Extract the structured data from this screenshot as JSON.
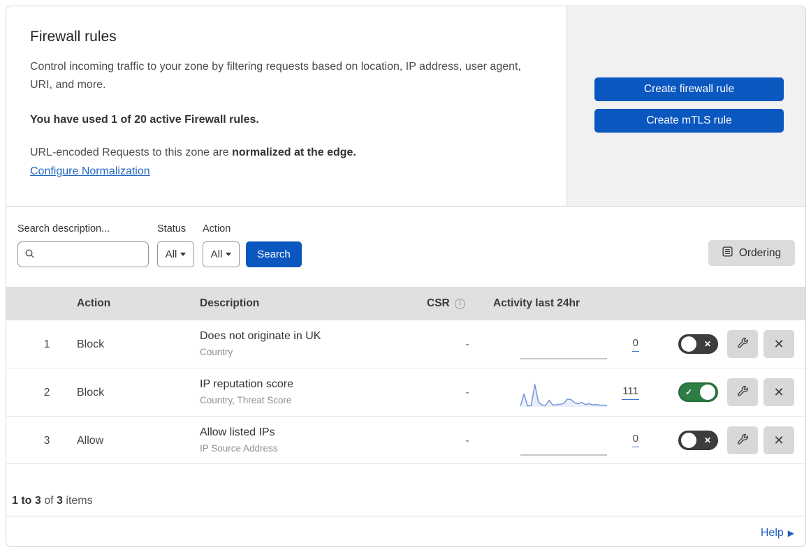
{
  "header": {
    "title": "Firewall rules",
    "description": "Control incoming traffic to your zone by filtering requests based on location, IP address, user agent, URI, and more.",
    "usage": "You have used 1 of 20 active Firewall rules.",
    "normalization_prefix": "URL-encoded Requests to this zone are ",
    "normalization_bold": "normalized at the edge.",
    "configure_link": "Configure Normalization",
    "create_firewall_button": "Create firewall rule",
    "create_mtls_button": "Create mTLS rule"
  },
  "filters": {
    "search_label": "Search description...",
    "status_label": "Status",
    "status_value": "All",
    "action_label": "Action",
    "action_value": "All",
    "search_button": "Search",
    "ordering_button": "Ordering"
  },
  "table": {
    "headers": {
      "action": "Action",
      "description": "Description",
      "csr": "CSR",
      "activity": "Activity last 24hr"
    },
    "rows": [
      {
        "index": "1",
        "action": "Block",
        "description": "Does not originate in UK",
        "fields": "Country",
        "csr": "-",
        "count": "0",
        "enabled": false,
        "sparkline": {
          "values": [
            0,
            0
          ],
          "color": "#b3b3b3"
        }
      },
      {
        "index": "2",
        "action": "Block",
        "description": "IP reputation score",
        "fields": "Country, Threat Score",
        "csr": "-",
        "count": "111",
        "enabled": true,
        "sparkline": {
          "values": [
            3,
            55,
            4,
            6,
            95,
            20,
            8,
            6,
            28,
            7,
            9,
            11,
            14,
            33,
            31,
            18,
            13,
            19,
            10,
            13,
            8,
            10,
            7,
            7,
            6
          ],
          "color": "#7296d8",
          "fill": "#e9effa"
        }
      },
      {
        "index": "3",
        "action": "Allow",
        "description": "Allow listed IPs",
        "fields": "IP Source Address",
        "csr": "-",
        "count": "0",
        "enabled": false,
        "sparkline": {
          "values": [
            0,
            0
          ],
          "color": "#b3b3b3"
        }
      }
    ]
  },
  "footer": {
    "range": "1 to 3",
    "of_text": "of",
    "total": "3",
    "items_text": "items",
    "help": "Help"
  },
  "icons": {
    "toggle_on": "✓",
    "toggle_off": "✕",
    "delete": "✕",
    "help_arrow": "▶"
  },
  "colors": {
    "primary_blue": "#0b57c0",
    "link_blue": "#2166c1",
    "toggle_on_green": "#2f7d46",
    "toggle_off_gray": "#3d3d3d",
    "spark_blue": "#7296d8",
    "header_bar_gray": "#e0e0e0",
    "panel_gray": "#f1f1f2"
  }
}
